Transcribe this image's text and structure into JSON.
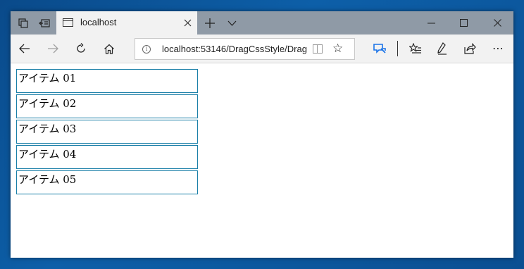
{
  "browser": {
    "tab": {
      "title": "localhost"
    },
    "address": {
      "url": "localhost:53146/DragCssStyle/Drag("
    },
    "icons": {
      "tab_set_aside": "tab-overview-icon",
      "set_aside": "set-aside-icon",
      "new_tab": "+",
      "tab_list": "chevron-down-icon",
      "minimize": "minimize-icon",
      "maximize": "maximize-icon",
      "close": "close-icon",
      "back": "←",
      "forward": "→",
      "refresh": "↻",
      "home": "⌂",
      "favorite": "☆",
      "more": "⋯"
    },
    "accent_color": "#1a73e8"
  },
  "page": {
    "items": [
      {
        "label": "アイテム 01"
      },
      {
        "label": "アイテム 02"
      },
      {
        "label": "アイテム 03"
      },
      {
        "label": "アイテム 04"
      },
      {
        "label": "アイテム 05"
      }
    ],
    "item_border_color": "#1a7fa8"
  }
}
